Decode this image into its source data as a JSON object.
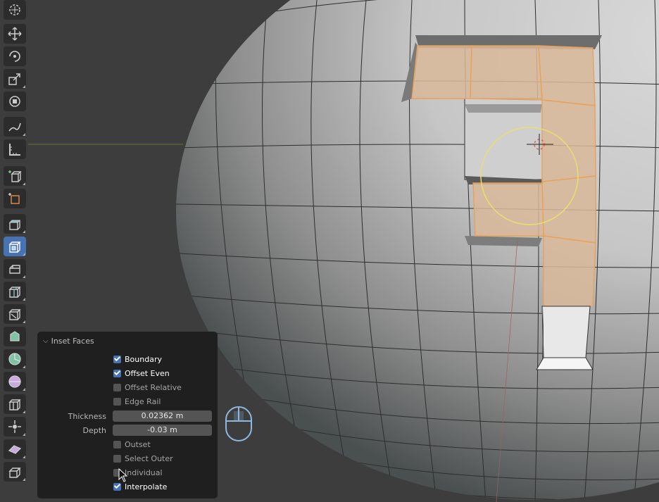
{
  "panel": {
    "title": "Inset Faces",
    "options": {
      "boundary": {
        "label": "Boundary",
        "checked": true
      },
      "offset_even": {
        "label": "Offset Even",
        "checked": true
      },
      "offset_relative": {
        "label": "Offset Relative",
        "checked": false
      },
      "edge_rail": {
        "label": "Edge Rail",
        "checked": false
      },
      "outset": {
        "label": "Outset",
        "checked": false
      },
      "select_outer": {
        "label": "Select Outer",
        "checked": false
      },
      "individual": {
        "label": "Individual",
        "checked": false
      },
      "interpolate": {
        "label": "Interpolate",
        "checked": true
      }
    },
    "thickness": {
      "label": "Thickness",
      "value": "0.02362 m"
    },
    "depth": {
      "label": "Depth",
      "value": "-0.03 m"
    }
  },
  "toolbar": {
    "tools": [
      "cursor-icon",
      "move-icon",
      "rotate-icon",
      "scale-icon",
      "transform-icon",
      "annotate-icon",
      "measure-icon",
      "add-cube-icon",
      "extrude-region-icon",
      "extrude-icon",
      "inset-faces-icon",
      "bevel-icon",
      "loop-cut-icon",
      "knife-icon",
      "poly-build-icon",
      "spin-icon",
      "smooth-icon",
      "to-sphere-icon",
      "edge-slide-icon",
      "shrink-fatten-icon",
      "shear-icon",
      "rip-region-icon"
    ],
    "active_tool": "inset-faces-icon"
  },
  "colors": {
    "selection": "#e8a15a",
    "selection_fill": "#c9a88a",
    "active_tool": "#4772b3",
    "brush_circle": "#e6e070"
  }
}
